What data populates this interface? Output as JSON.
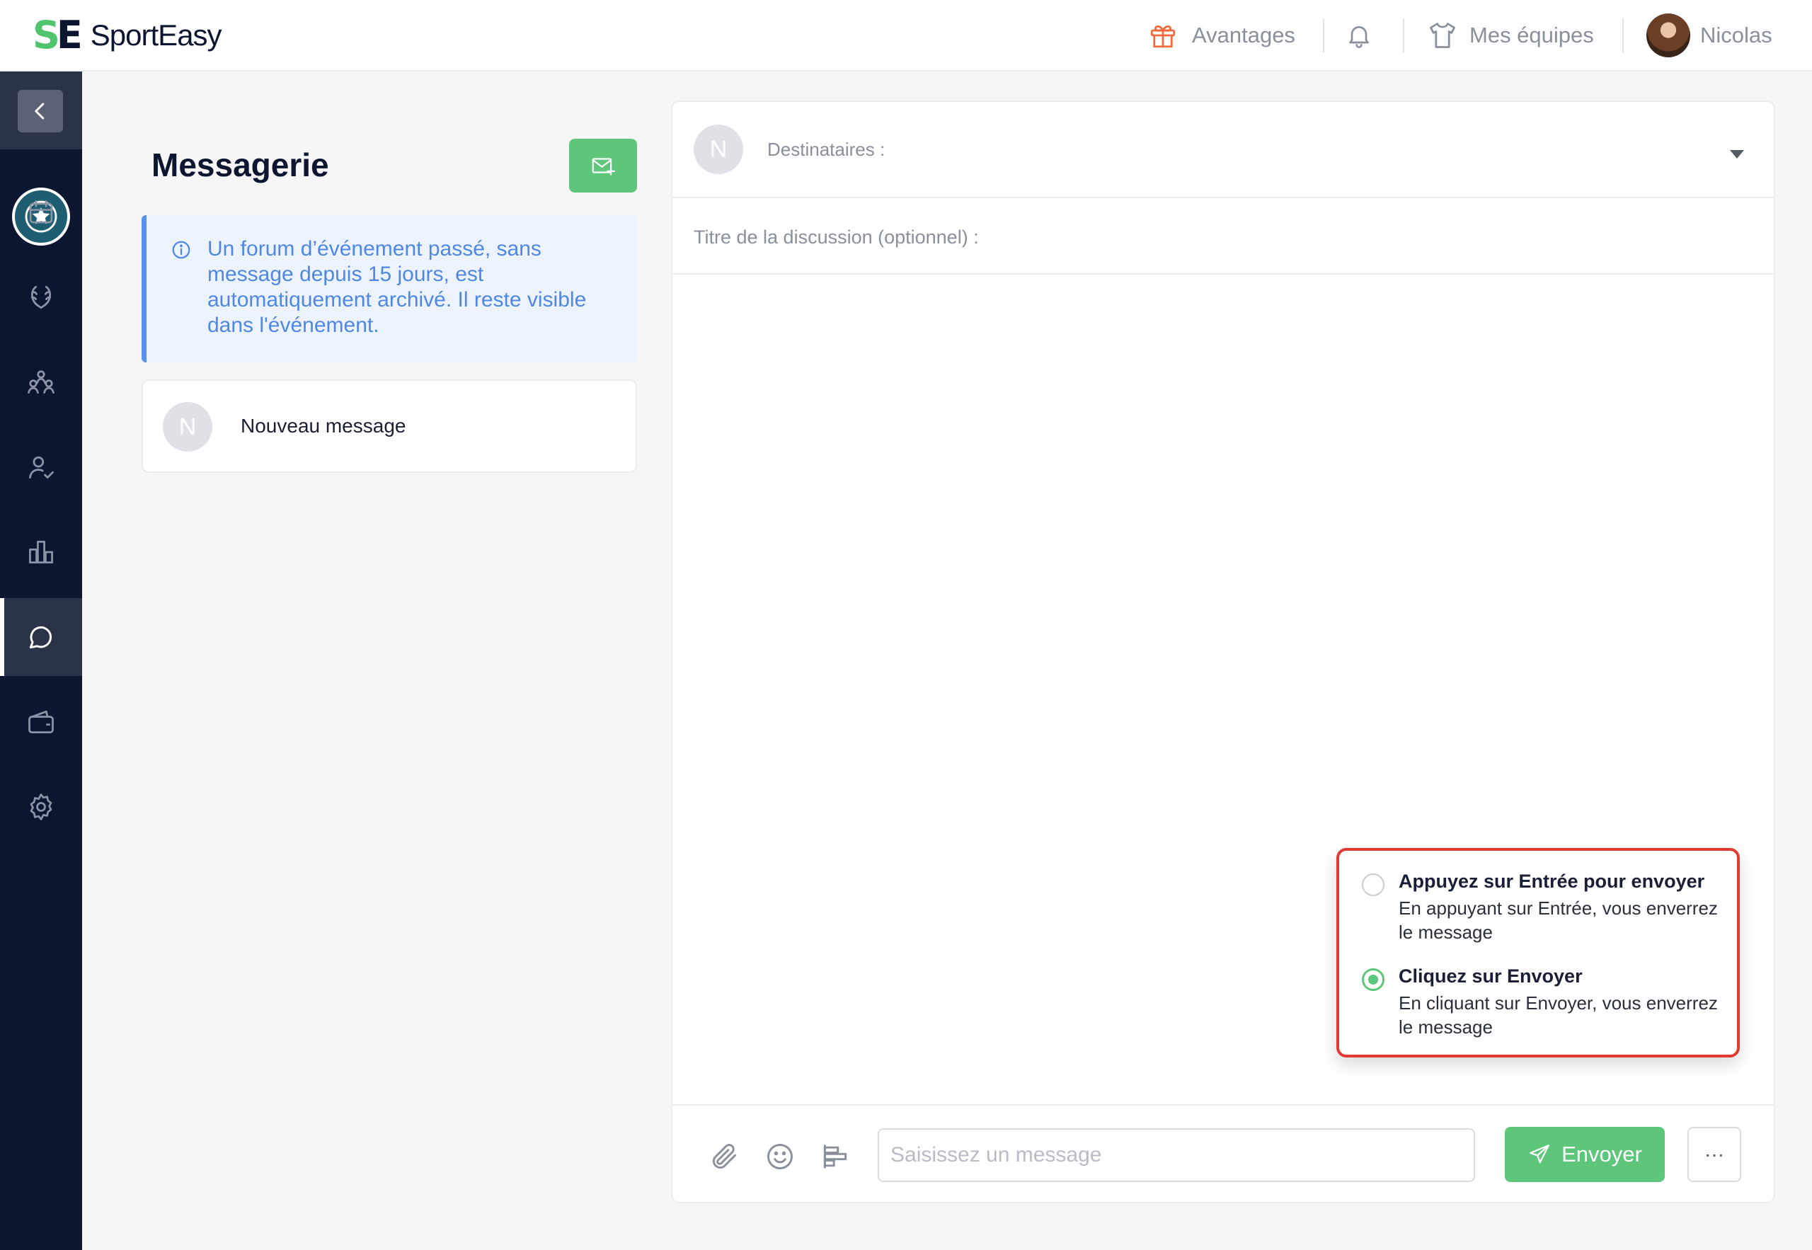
{
  "brand": {
    "mark_s": "S",
    "mark_e": "E",
    "name": "SportEasy",
    "accent": "#4fc46d",
    "dark": "#0d1630"
  },
  "topbar": {
    "perks_label": "Avantages",
    "perks_icon": "gift-icon",
    "notifications_icon": "bell-icon",
    "teams_label": "Mes équipes",
    "teams_icon": "jersey-icon",
    "user_name": "Nicolas"
  },
  "sidebar": {
    "items": [
      {
        "name": "calendar",
        "icon": "calendar-icon"
      },
      {
        "name": "trophies",
        "icon": "laurel-icon"
      },
      {
        "name": "team",
        "icon": "team-icon"
      },
      {
        "name": "attendance",
        "icon": "user-check-icon"
      },
      {
        "name": "stats",
        "icon": "bar-chart-icon"
      },
      {
        "name": "messages",
        "icon": "chat-icon",
        "active": true
      },
      {
        "name": "wallet",
        "icon": "wallet-icon"
      },
      {
        "name": "settings",
        "icon": "gear-icon"
      }
    ]
  },
  "messaging": {
    "title": "Messagerie",
    "info": "Un forum d’événement passé, sans message depuis 15 jours, est automatiquement archivé. Il reste visible dans l'événement.",
    "conversations": [
      {
        "avatar_letter": "N",
        "label": "Nouveau message"
      }
    ]
  },
  "compose": {
    "avatar_letter": "N",
    "recipients_label": "Destinataires :",
    "title_label": "Titre de la discussion (optionnel) :",
    "message_placeholder": "Saisissez un message",
    "send_label": "Envoyer",
    "more_label": "···"
  },
  "send_options": [
    {
      "title": "Appuyez sur Entrée pour envoyer",
      "description": "En appuyant sur Entrée, vous enverrez le message",
      "selected": false
    },
    {
      "title": "Cliquez sur Envoyer",
      "description": "En cliquant sur Envoyer, vous enverrez le message",
      "selected": true
    }
  ]
}
